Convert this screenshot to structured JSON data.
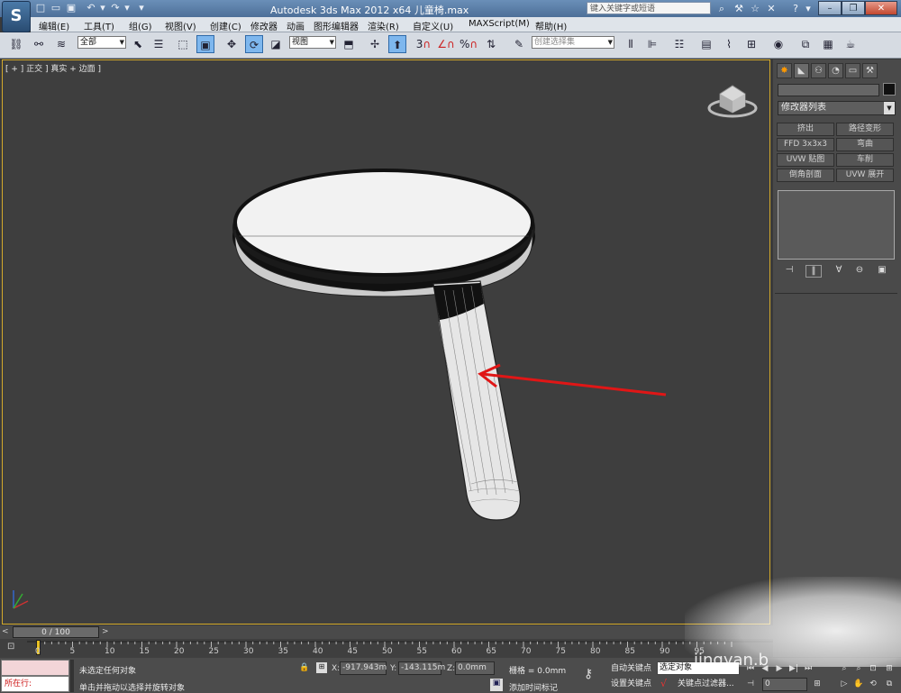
{
  "titlebar": {
    "title": "Autodesk 3ds Max  2012 x64      儿童椅.max",
    "search_placeholder": "键入关键字或短语",
    "help_label": "?"
  },
  "menubar": {
    "items": [
      "编辑(E)",
      "工具(T)",
      "组(G)",
      "视图(V)",
      "创建(C)",
      "修改器",
      "动画",
      "图形编辑器",
      "渲染(R)",
      "自定义(U)",
      "MAXScript(M)",
      "帮助(H)"
    ]
  },
  "toolbar": {
    "selection_filter": "全部",
    "ref_coord": "视图",
    "snap_3": "3",
    "snap_pct": "%",
    "named_selection": "创建选择集"
  },
  "viewport": {
    "label": "[ + ] 正交 ] 真实 + 边面 ]"
  },
  "command_panel": {
    "modifier_list": "修改器列表",
    "buttons": [
      "挤出",
      "路径变形",
      "FFD 3x3x3",
      "弯曲",
      "UVW 贴图",
      "车削",
      "倒角剖面",
      "UVW 展开"
    ]
  },
  "timeline": {
    "frame_display": "0 / 100",
    "ticks": [
      "0",
      "5",
      "10",
      "15",
      "20",
      "25",
      "30",
      "35",
      "40",
      "45",
      "50",
      "55",
      "60",
      "65",
      "70",
      "75",
      "80",
      "85",
      "90",
      "95"
    ]
  },
  "statusbar": {
    "maxscript_label": "所在行:",
    "status_line": "未选定任何对象",
    "prompt_line": "单击并拖动以选择并旋转对象",
    "x_label": "X:",
    "x_value": "-917.943m",
    "y_label": "Y:",
    "y_value": "-143.115m",
    "z_label": "Z:",
    "z_value": "0.0mm",
    "grid": "栅格 = 0.0mm",
    "add_time_tag": "添加时间标记",
    "auto_key": "自动关键点",
    "set_key": "设置关键点",
    "selected_object": "选定对象",
    "key_filters": "关键点过滤器...",
    "frame_value": "0"
  },
  "watermark": "jingyan.b"
}
